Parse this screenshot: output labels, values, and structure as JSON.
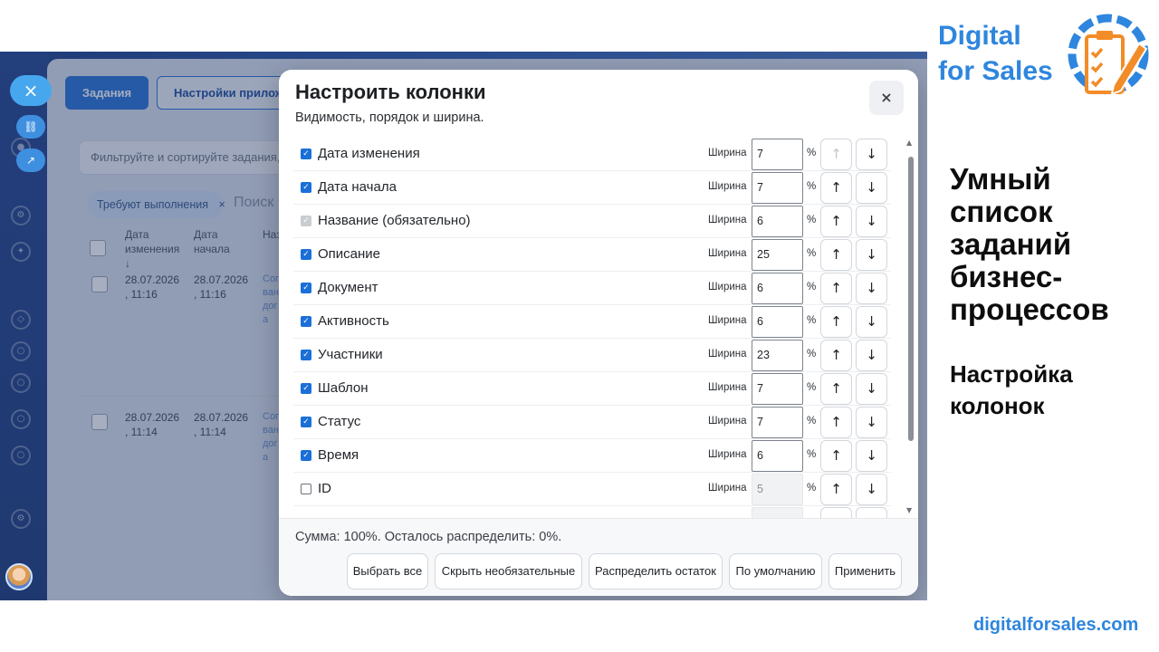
{
  "app": {
    "tab_tasks": "Задания",
    "tab_settings": "Настройки прилож",
    "filter_placeholder": "Фильтруйте и сортируйте задания, ",
    "chip_label": "Требуют выполнения",
    "chip_close": "×",
    "search_ghost": "Поиск",
    "columns": [
      "Дата изменения ↓",
      "Дата начала",
      "Название"
    ],
    "rows": [
      {
        "modified": "28.07.2026 , 11:16",
        "started": "28.07.2026 , 11:16",
        "title": "Сог ван дог а"
      },
      {
        "modified": "28.07.2026 , 11:14",
        "started": "28.07.2026 , 11:14",
        "title": "Сог ван дог а"
      }
    ]
  },
  "modal": {
    "title": "Настроить колонки",
    "subtitle": "Видимость, порядок и ширина.",
    "close": "×",
    "width_label": "Ширина",
    "percent": "%",
    "up": "↑",
    "down": "↓",
    "columns": [
      {
        "label": "Дата изменения",
        "checked": true,
        "disabled": false,
        "width": "7",
        "up_disabled": true
      },
      {
        "label": "Дата начала",
        "checked": true,
        "disabled": false,
        "width": "7",
        "up_disabled": false
      },
      {
        "label": "Название (обязательно)",
        "checked": true,
        "disabled": true,
        "width": "6",
        "up_disabled": false
      },
      {
        "label": "Описание",
        "checked": true,
        "disabled": false,
        "width": "25",
        "up_disabled": false
      },
      {
        "label": "Документ",
        "checked": true,
        "disabled": false,
        "width": "6",
        "up_disabled": false
      },
      {
        "label": "Активность",
        "checked": true,
        "disabled": false,
        "width": "6",
        "up_disabled": false
      },
      {
        "label": "Участники",
        "checked": true,
        "disabled": false,
        "width": "23",
        "up_disabled": false
      },
      {
        "label": "Шаблон",
        "checked": true,
        "disabled": false,
        "width": "7",
        "up_disabled": false
      },
      {
        "label": "Статус",
        "checked": true,
        "disabled": false,
        "width": "7",
        "up_disabled": false
      },
      {
        "label": "Время",
        "checked": true,
        "disabled": false,
        "width": "6",
        "up_disabled": false
      },
      {
        "label": "ID",
        "checked": false,
        "disabled": false,
        "width": "5",
        "up_disabled": false,
        "width_disabled": true
      }
    ],
    "sum_text": "Сумма: 100%. Осталось распределить: 0%.",
    "buttons": {
      "select_all": "Выбрать все",
      "hide_optional": "Скрыть необязательные",
      "distribute": "Распределить остаток",
      "defaults": "По умолчанию",
      "apply": "Применить"
    }
  },
  "branding": {
    "line1": "Digital",
    "line2": "for Sales",
    "headline": "Умный список заданий бизнес-процессов",
    "subheadline": "Настройка колонок",
    "site": "digitalforsales.com",
    "brand_color": "#2e86de",
    "accent_color": "#f28c28"
  }
}
